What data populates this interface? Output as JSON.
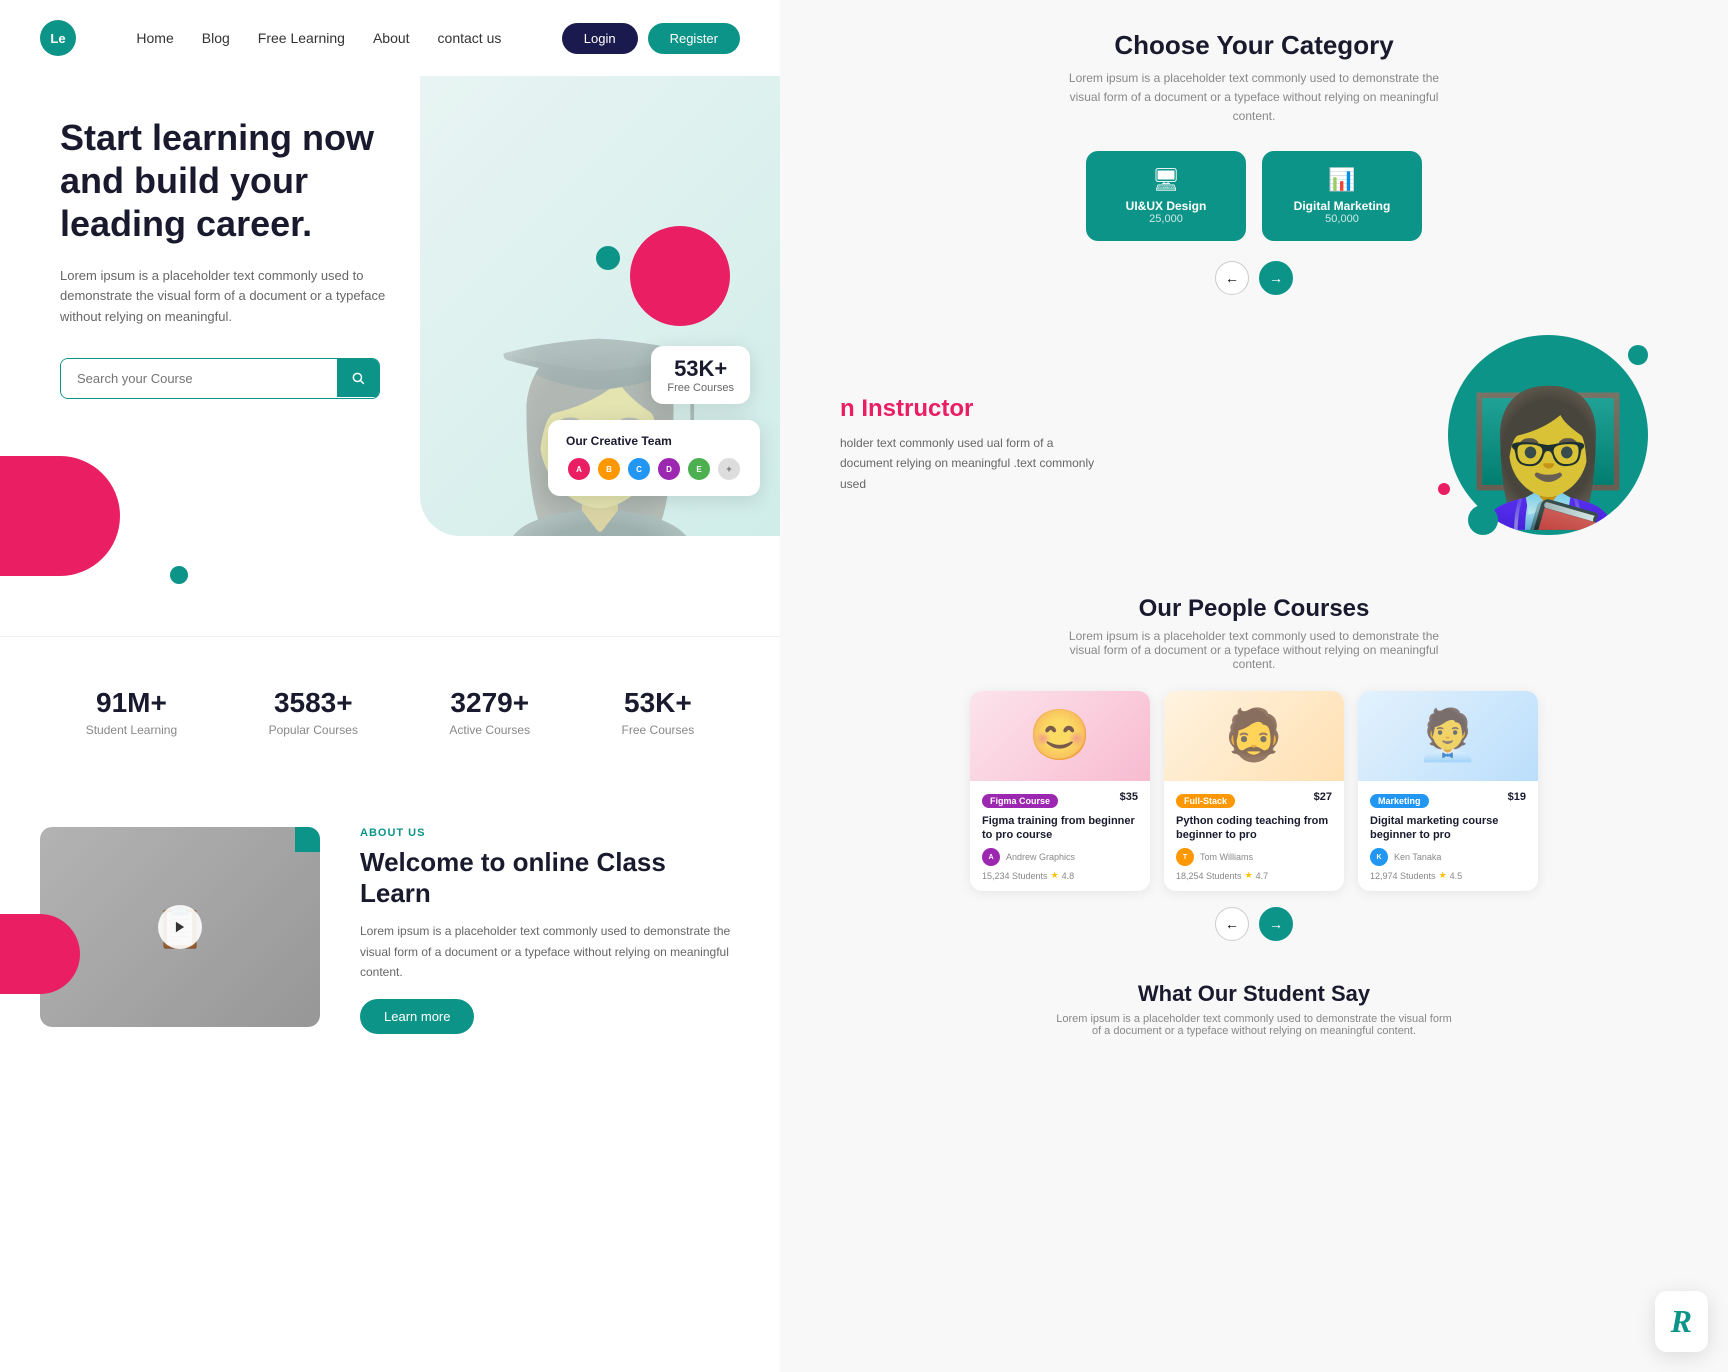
{
  "navbar": {
    "logo_text": "Le",
    "links": [
      "Home",
      "Blog",
      "Free Learning",
      "About",
      "contact us"
    ],
    "login_label": "Login",
    "register_label": "Register"
  },
  "hero": {
    "title": "Start learning now and build your leading career.",
    "description": "Lorem ipsum is a placeholder text commonly used to demonstrate the visual form of a document or a typeface without relying on meaningful.",
    "search_placeholder": "Search your Course",
    "courses_badge": {
      "count": "53K+",
      "label": "Free Courses"
    },
    "team_card": {
      "title": "Our Creative Team"
    }
  },
  "stats": [
    {
      "number": "91M+",
      "label": "Student Learning"
    },
    {
      "number": "3583+",
      "label": "Popular Courses"
    },
    {
      "number": "3279+",
      "label": "Active Courses"
    },
    {
      "number": "53K+",
      "label": "Free Courses"
    }
  ],
  "about": {
    "tag": "ABOUT US",
    "title": "Welcome to online Class Learn",
    "description": "Lorem ipsum is a placeholder text commonly used to demonstrate the visual form of a document or a typeface without relying on meaningful content.",
    "learn_more": "Learn more"
  },
  "category": {
    "title": "Choose Your Category",
    "description": "Lorem ipsum is a placeholder text commonly used to demonstrate the visual form of a document or a typeface without relying on meaningful content.",
    "cards": [
      {
        "icon": "🖥",
        "name": "UI&UX Design",
        "count": "25,000"
      },
      {
        "icon": "📊",
        "name": "Digital Marketing",
        "count": "50,000"
      }
    ],
    "nav_prev": "←",
    "nav_next": "→"
  },
  "instructor": {
    "title_prefix": "n Instructor",
    "description": "holder text commonly used\nual form of a document\nrelying on meaningful\n.text commonly used"
  },
  "courses": {
    "title": "Our People Courses",
    "description": "Lorem ipsum is a placeholder text commonly used to demonstrate the visual form of a document or a typeface without relying on meaningful content.",
    "items": [
      {
        "tag": "Figma Course",
        "tag_class": "tag-figma",
        "price": "$35",
        "name": "Figma training from beginner to pro course",
        "instructor": "Andrew Graphics",
        "students": "15,234 Students",
        "rating": "4.8",
        "img_class": "course-img-1",
        "av_bg": "#9c27b0",
        "av_letter": "A"
      },
      {
        "tag": "Full-Stack",
        "tag_class": "tag-python",
        "price": "$27",
        "name": "Python coding teaching from beginner to pro",
        "instructor": "Tom Williams",
        "students": "18,254 Students",
        "rating": "4.7",
        "img_class": "course-img-2",
        "av_bg": "#ff9800",
        "av_letter": "T"
      },
      {
        "tag": "Marketing",
        "tag_class": "tag-marketing",
        "price": "$19",
        "name": "Digital marketing course beginner to pro",
        "instructor": "Ken Tanaka",
        "students": "12,974 Students",
        "rating": "4.5",
        "img_class": "course-img-3",
        "av_bg": "#2196f3",
        "av_letter": "K"
      }
    ],
    "nav_prev": "←",
    "nav_next": "→"
  },
  "student_say": {
    "title": "What Our Student Say",
    "description": "Lorem ipsum is a placeholder text commonly used to demonstrate the visual form of a document or a typeface without relying on meaningful content."
  },
  "watermark": {
    "icon": "R"
  }
}
